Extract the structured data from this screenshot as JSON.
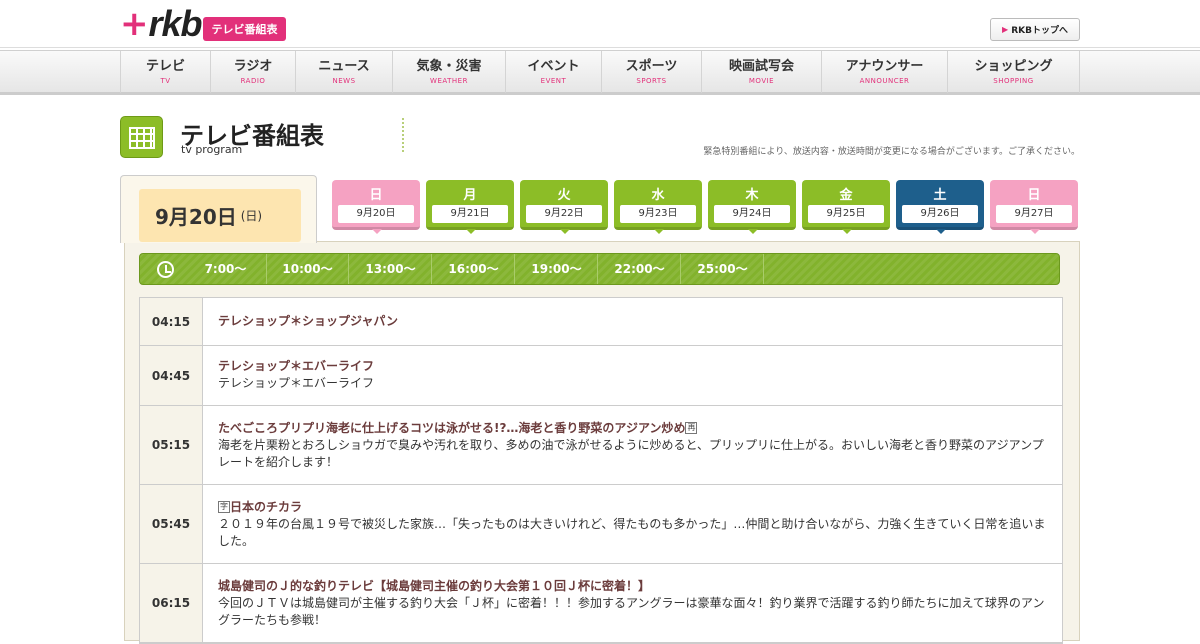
{
  "header": {
    "logo_plus": "+",
    "logo_text": "rkb",
    "badge": "テレビ番組表",
    "top_link": "RKBトップへ"
  },
  "nav": [
    {
      "jp": "テレビ",
      "en": "TV"
    },
    {
      "jp": "ラジオ",
      "en": "RADIO"
    },
    {
      "jp": "ニュース",
      "en": "NEWS"
    },
    {
      "jp": "気象・災害",
      "en": "WEATHER"
    },
    {
      "jp": "イベント",
      "en": "EVENT"
    },
    {
      "jp": "スポーツ",
      "en": "SPORTS"
    },
    {
      "jp": "映画試写会",
      "en": "MOVIE"
    },
    {
      "jp": "アナウンサー",
      "en": "ANNOUNCER"
    },
    {
      "jp": "ショッピング",
      "en": "SHOPPING"
    }
  ],
  "page": {
    "title": "テレビ番組表",
    "subtitle": "tv program",
    "notice": "緊急特別番組により、放送内容・放送時間が変更になる場合がございます。ご了承ください。"
  },
  "current_date": {
    "date": "9月20日",
    "dow": "(日)"
  },
  "days": [
    {
      "dow": "日",
      "date": "9月20日",
      "color": "#f5a2c2"
    },
    {
      "dow": "月",
      "date": "9月21日",
      "color": "#8cbd27"
    },
    {
      "dow": "火",
      "date": "9月22日",
      "color": "#8cbd27"
    },
    {
      "dow": "水",
      "date": "9月23日",
      "color": "#8cbd27"
    },
    {
      "dow": "木",
      "date": "9月24日",
      "color": "#8cbd27"
    },
    {
      "dow": "金",
      "date": "9月25日",
      "color": "#8cbd27"
    },
    {
      "dow": "土",
      "date": "9月26日",
      "color": "#1e5f8c"
    },
    {
      "dow": "日",
      "date": "9月27日",
      "color": "#f5a2c2"
    }
  ],
  "times": [
    "7:00～",
    "10:00～",
    "13:00～",
    "16:00～",
    "19:00～",
    "22:00～",
    "25:00～"
  ],
  "programs": [
    {
      "time": "04:15",
      "title": "テレショップ＊ショップジャパン",
      "desc": "",
      "mark_before": "",
      "mark_after": ""
    },
    {
      "time": "04:45",
      "title": "テレショップ＊エバーライフ",
      "desc": "テレショップ＊エバーライフ",
      "mark_before": "",
      "mark_after": ""
    },
    {
      "time": "05:15",
      "title": "たべごころプリプリ海老に仕上げるコツは泳がせる!?…海老と香り野菜のアジアン炒め",
      "desc": "海老を片栗粉とおろしショウガで臭みや汚れを取り、多めの油で泳がせるように炒めると、プリップリに仕上がる。おいしい海老と香り野菜のアジアンプレートを紹介します！",
      "mark_before": "",
      "mark_after": "再"
    },
    {
      "time": "05:45",
      "title": "日本のチカラ",
      "desc": "２０１９年の台風１９号で被災した家族…「失ったものは大きいけれど、得たものも多かった」…仲間と助け合いながら、力強く生きていく日常を追いました。",
      "mark_before": "字",
      "mark_after": ""
    },
    {
      "time": "06:15",
      "title": "城島健司のＪ的な釣りテレビ【城島健司主催の釣り大会第１０回Ｊ杯に密着！】",
      "desc": "今回のＪＴＶは城島健司が主催する釣り大会「Ｊ杯」に密着！！！参加するアングラーは豪華な面々！釣り業界で活躍する釣り師たちに加えて球界のアングラーたちも参戦！",
      "mark_before": "",
      "mark_after": ""
    }
  ]
}
